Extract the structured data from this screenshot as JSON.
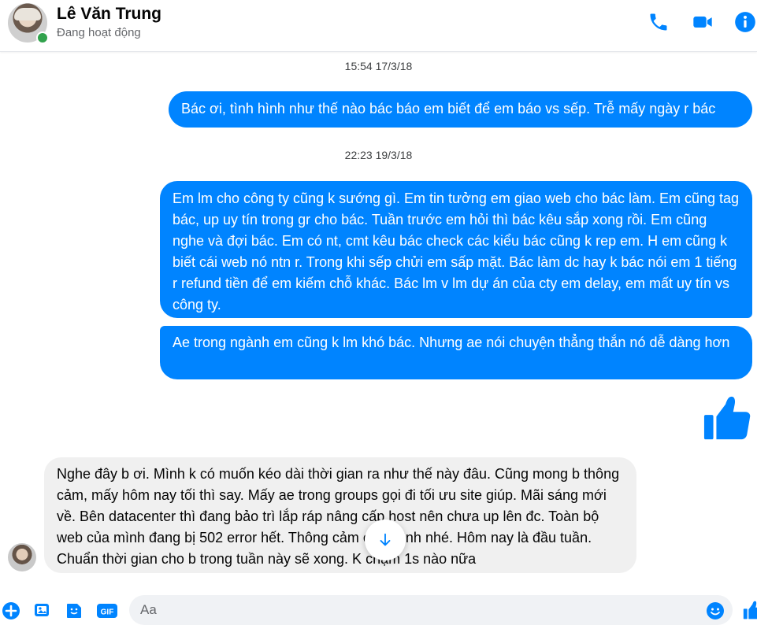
{
  "header": {
    "name": "Lê Văn Trung",
    "status": "Đang hoạt động"
  },
  "colors": {
    "accent": "#0084ff",
    "incoming_bubble": "#f0f0f0",
    "online": "#31a24c"
  },
  "messages": [
    {
      "type": "timestamp",
      "text": "15:54 17/3/18"
    },
    {
      "type": "outgoing",
      "text": "Bác ơi, tình hình như thế nào bác báo em biết để em báo vs sếp. Trễ mấy ngày r bác"
    },
    {
      "type": "timestamp",
      "text": "22:23 19/3/18"
    },
    {
      "type": "outgoing",
      "text": "Em lm cho công ty cũng k sướng gì. Em tin tưởng em giao web cho bác làm. Em cũng tag bác, up uy tín trong gr cho bác. Tuần trước em hỏi thì bác kêu sắp xong rồi. Em cũng nghe và đợi bác. Em có nt, cmt kêu bác check các kiểu bác cũng k rep em. H em cũng k biết cái web nó ntn r. Trong khi sếp chửi em sấp mặt. Bác làm dc hay k bác nói em 1 tiếng r refund tiền để em kiếm chỗ khác. Bác lm v lm dự án của cty em delay, em mất uy tín vs công ty."
    },
    {
      "type": "outgoing",
      "text": "Ae trong ngành em cũng k lm khó bác. Nhưng ae nói chuyện thẳng thắn nó dễ dàng hơn"
    },
    {
      "type": "incoming",
      "text": "Nghe đây b ơi. Mình k có muốn kéo dài thời gian ra như thế này đâu. Cũng mong b thông cảm, mấy hôm nay tối thì say. Mấy ae trong groups gọi đi tối ưu site giúp. Mãi sáng mới về. Bên datacenter thì đang bảo trì lắp ráp nâng cấp host nên chưa up lên đc. Toàn bộ web của mình đang bị 502 error hết. Thông cảm cho mình nhé. Hôm nay là đầu tuần. Chuẩn thời gian cho b trong tuần này sẽ xong. K chậm 1s nào nữa"
    }
  ],
  "icons": {
    "call": "phone-icon",
    "video": "video-camera-icon",
    "info": "info-icon",
    "like": "thumbs-up-icon",
    "scroll": "arrow-down-icon",
    "composer": [
      "plus-circle-icon",
      "image-icon",
      "sticker-icon",
      "gif-icon",
      "emoji-icon",
      "thumbs-up-icon"
    ]
  },
  "composer": {
    "placeholder": "Aa",
    "gif_label": "GIF"
  }
}
